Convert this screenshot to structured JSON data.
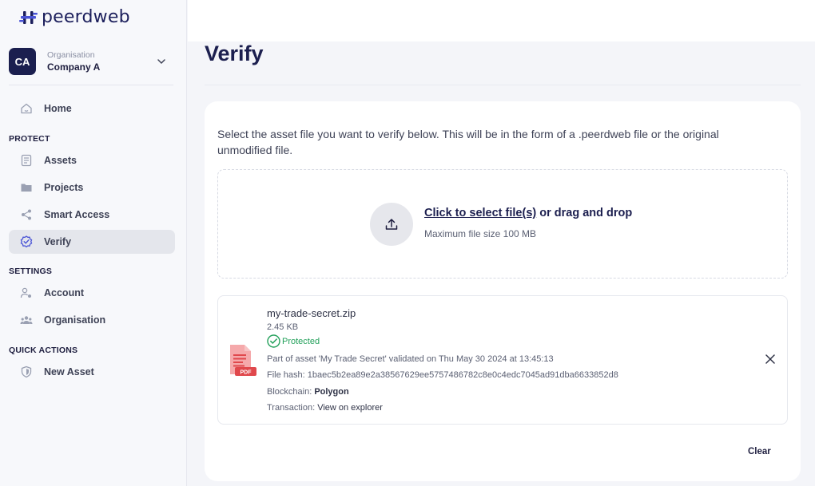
{
  "brand": {
    "name": "peerdweb"
  },
  "organisation": {
    "avatar": "CA",
    "label": "Organisation",
    "name": "Company A"
  },
  "nav": {
    "home": "Home",
    "sections": {
      "protect": "PROTECT",
      "settings": "SETTINGS",
      "quick_actions": "QUICK ACTIONS"
    },
    "protect_items": [
      {
        "label": "Assets",
        "icon": "assets-icon"
      },
      {
        "label": "Projects",
        "icon": "folder-icon"
      },
      {
        "label": "Smart Access",
        "icon": "share-icon"
      },
      {
        "label": "Verify",
        "icon": "verify-badge-icon",
        "active": true
      }
    ],
    "settings_items": [
      {
        "label": "Account",
        "icon": "account-icon"
      },
      {
        "label": "Organisation",
        "icon": "users-icon"
      }
    ],
    "quick_items": [
      {
        "label": "New Asset",
        "icon": "shield-icon"
      }
    ]
  },
  "page": {
    "title": "Verify"
  },
  "verify": {
    "intro": "Select the asset file you want to verify below. This will be in the form of a .peerdweb file or the original unmodified file.",
    "upload_link": "Click to select file(s)",
    "upload_rest": " or drag and drop",
    "upload_sub": "Maximum file size 100 MB",
    "file": {
      "name": "my-trade-secret.zip",
      "size": "2.45 KB",
      "status": "Protected",
      "validated": "Part of asset 'My Trade Secret' validated on Thu May 30 2024 at 13:45:13",
      "hash_label": "File hash: ",
      "hash": "1baec5b2ea89e2a38567629ee5757486782c8e0c4edc7045ad91dba6633852d8",
      "chain_label": "Blockchain: ",
      "chain": "Polygon",
      "tx_label": "Transaction: ",
      "tx_link": "View on explorer",
      "file_badge": "PDF"
    },
    "clear_label": "Clear"
  },
  "colors": {
    "navy": "#1c1f4f",
    "accent": "#4a54d6",
    "success": "#22a05a",
    "pdf": "#e0484c"
  }
}
